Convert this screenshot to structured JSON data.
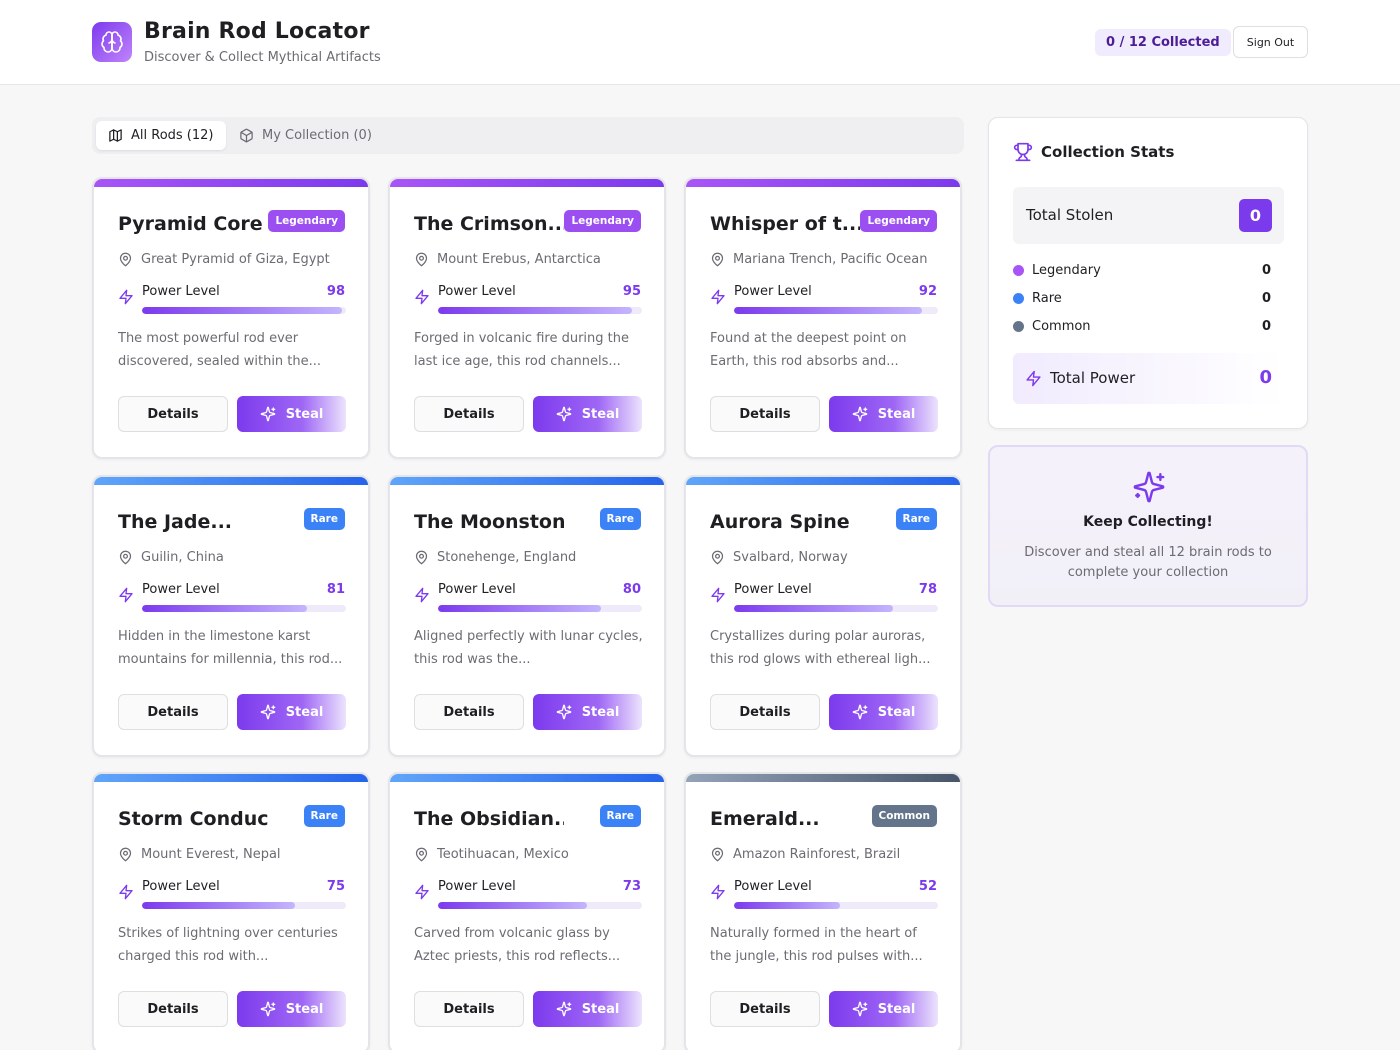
{
  "header": {
    "title": "Brain Rod Locator",
    "subtitle": "Discover & Collect Mythical Artifacts",
    "collected": "0 / 12 Collected",
    "signout": "Sign Out"
  },
  "tabs": [
    {
      "label": "All Rods (12)",
      "icon": "map-icon",
      "active": true
    },
    {
      "label": "My Collection (0)",
      "icon": "box-icon",
      "active": false
    }
  ],
  "rods": [
    {
      "title": "Pyramid Core",
      "rarity": "Legendary",
      "location": "Great Pyramid of Giza, Egypt",
      "power_label": "Power Level",
      "power": 98,
      "description": "The most powerful rod ever discovered, sealed within the...",
      "details": "Details",
      "steal": "Steal"
    },
    {
      "title": "The Crimson...",
      "rarity": "Legendary",
      "location": "Mount Erebus, Antarctica",
      "power_label": "Power Level",
      "power": 95,
      "description": "Forged in volcanic fire during the last ice age, this rod channels...",
      "details": "Details",
      "steal": "Steal"
    },
    {
      "title": "Whisper of t...",
      "rarity": "Legendary",
      "location": "Mariana Trench, Pacific Ocean",
      "power_label": "Power Level",
      "power": 92,
      "description": "Found at the deepest point on Earth, this rod absorbs and...",
      "details": "Details",
      "steal": "Steal"
    },
    {
      "title": "The Jade...",
      "rarity": "Rare",
      "location": "Guilin, China",
      "power_label": "Power Level",
      "power": 81,
      "description": "Hidden in the limestone karst mountains for millennia, this rod...",
      "details": "Details",
      "steal": "Steal"
    },
    {
      "title": "The Moonstone...",
      "rarity": "Rare",
      "location": "Stonehenge, England",
      "power_label": "Power Level",
      "power": 80,
      "description": "Aligned perfectly with lunar cycles, this rod was the...",
      "details": "Details",
      "steal": "Steal"
    },
    {
      "title": "Aurora Spine",
      "rarity": "Rare",
      "location": "Svalbard, Norway",
      "power_label": "Power Level",
      "power": 78,
      "description": "Crystallizes during polar auroras, this rod glows with ethereal ligh...",
      "details": "Details",
      "steal": "Steal"
    },
    {
      "title": "Storm Conductor",
      "rarity": "Rare",
      "location": "Mount Everest, Nepal",
      "power_label": "Power Level",
      "power": 75,
      "description": "Strikes of lightning over centuries charged this rod with...",
      "details": "Details",
      "steal": "Steal"
    },
    {
      "title": "The Obsidian...",
      "rarity": "Rare",
      "location": "Teotihuacan, Mexico",
      "power_label": "Power Level",
      "power": 73,
      "description": "Carved from volcanic glass by Aztec priests, this rod reflects...",
      "details": "Details",
      "steal": "Steal"
    },
    {
      "title": "Emerald...",
      "rarity": "Common",
      "location": "Amazon Rainforest, Brazil",
      "power_label": "Power Level",
      "power": 52,
      "description": "Naturally formed in the heart of the jungle, this rod pulses with...",
      "details": "Details",
      "steal": "Steal"
    }
  ],
  "stats": {
    "title": "Collection Stats",
    "total_stolen_label": "Total Stolen",
    "total_stolen_value": "0",
    "rows": [
      {
        "label": "Legendary",
        "count": "0",
        "color": "#a855f7"
      },
      {
        "label": "Rare",
        "count": "0",
        "color": "#3b82f6"
      },
      {
        "label": "Common",
        "count": "0",
        "color": "#64748b"
      }
    ],
    "total_power_label": "Total Power",
    "total_power_value": "0"
  },
  "keep": {
    "title": "Keep Collecting!",
    "text": "Discover and steal all 12 brain rods to complete your collection"
  },
  "colors": {
    "accent": "#7c3aed",
    "legendary": "#9b4ff0",
    "rare": "#3b82f6",
    "common": "#64748b"
  }
}
